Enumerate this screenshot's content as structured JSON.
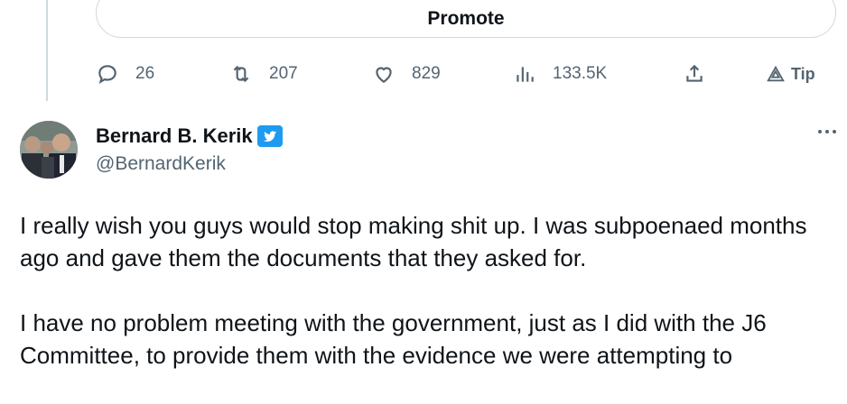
{
  "promote": {
    "label": "Promote"
  },
  "actions": {
    "replies": "26",
    "retweets": "207",
    "likes": "829",
    "views": "133.5K",
    "tip_label": "Tip",
    "icons": [
      "reply-icon",
      "retweet-icon",
      "like-icon",
      "views-icon",
      "share-icon",
      "tip-icon"
    ]
  },
  "tweet": {
    "author": {
      "display_name": "Bernard B. Kerik",
      "handle": "@BernardKerik",
      "verified_badge": "verified-badge-icon"
    },
    "paragraphs": [
      "I really wish you guys would stop making shit up. I was subpoenaed months ago and gave them the documents that they asked for.",
      "I have no problem meeting with the government, just as I did with the J6 Committee, to provide them with the evidence we were attempting to"
    ]
  },
  "colors": {
    "accent": "#1d9bf0",
    "text_primary": "#0f1419",
    "text_secondary": "#536471",
    "border": "#cfd9de"
  }
}
